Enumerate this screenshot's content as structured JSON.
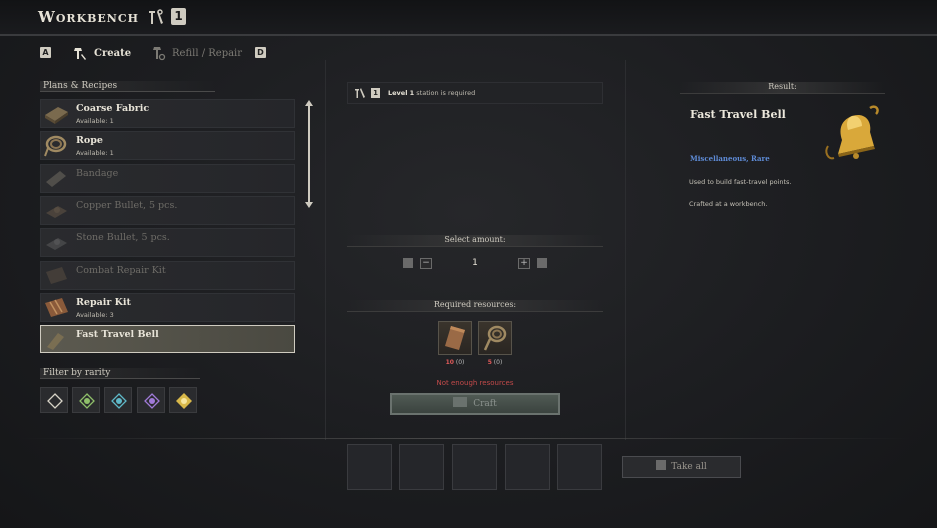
{
  "header": {
    "title": "Workbench",
    "level": "1",
    "key_left": "A",
    "key_right": "D",
    "tabs": [
      {
        "label": "Create",
        "active": true
      },
      {
        "label": "Refill / Repair",
        "active": false
      }
    ]
  },
  "plans": {
    "heading": "Plans & Recipes",
    "items": [
      {
        "name": "Coarse Fabric",
        "availability": "Available: 1",
        "enabled": true,
        "icon": "fabric-icon"
      },
      {
        "name": "Rope",
        "availability": "Available: 1",
        "enabled": true,
        "icon": "rope-icon"
      },
      {
        "name": "Bandage",
        "availability": "",
        "enabled": false,
        "icon": "bandage-icon"
      },
      {
        "name": "Copper Bullet, 5 pcs.",
        "availability": "",
        "enabled": false,
        "icon": "copper-bullet-icon"
      },
      {
        "name": "Stone Bullet, 5 pcs.",
        "availability": "",
        "enabled": false,
        "icon": "stone-bullet-icon"
      },
      {
        "name": "Combat Repair Kit",
        "availability": "",
        "enabled": false,
        "icon": "combat-repair-kit-icon"
      },
      {
        "name": "Repair Kit",
        "availability": "Available: 3",
        "enabled": true,
        "icon": "repair-kit-icon"
      },
      {
        "name": "Fast Travel Bell",
        "availability": "",
        "enabled": true,
        "selected": true,
        "icon": "bell-icon"
      }
    ]
  },
  "filter": {
    "heading": "Filter by rarity",
    "rarities": [
      {
        "name": "common",
        "color": "#d8d4c8"
      },
      {
        "name": "uncommon",
        "color": "#8fbf6a"
      },
      {
        "name": "rare",
        "color": "#5fb8c8"
      },
      {
        "name": "epic",
        "color": "#a07ad8"
      },
      {
        "name": "legendary",
        "color": "#d8b84a"
      }
    ]
  },
  "station": {
    "level_badge": "1",
    "level_text": "Level 1",
    "requirement_text": " station is required"
  },
  "amount": {
    "heading": "Select amount:",
    "value": "1"
  },
  "resources": {
    "heading": "Required resources:",
    "items": [
      {
        "icon": "fabric-icon",
        "need": "10",
        "have": "(0)"
      },
      {
        "icon": "rope-icon",
        "need": "5",
        "have": "(0)"
      }
    ],
    "warning": "Not enough resources",
    "craft_label": "Craft"
  },
  "result": {
    "heading": "Result:",
    "title": "Fast Travel Bell",
    "category": "Miscellaneous, Rare",
    "desc_1": "Used to build fast-travel points.",
    "desc_2": "Crafted at a workbench."
  },
  "output": {
    "take_all_label": "Take all"
  },
  "colors": {
    "accent": "#cfcbc0",
    "rare_blue": "#5e8bd6",
    "warning_red": "#c34a4a"
  }
}
